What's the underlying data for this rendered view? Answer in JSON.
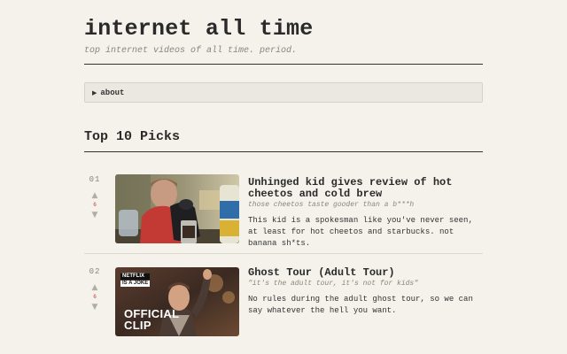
{
  "site": {
    "title": "internet all time",
    "tagline": "top internet videos of all time. period."
  },
  "about": {
    "label": "about",
    "arrow_icon": "triangle-right-icon"
  },
  "picks": {
    "heading": "Top 10 Picks",
    "items": [
      {
        "rank": "01",
        "title": "Unhinged kid gives review of hot cheetos and cold brew",
        "subtitle": "those cheetos taste gooder than a b***h",
        "description": "This kid is a spokesman like you've never seen, at least for hot cheetos and starbucks. not banana sh*ts.",
        "vote_count": "6",
        "thumbnail": {
          "kind": "video-thumbnail"
        }
      },
      {
        "rank": "02",
        "title": "Ghost Tour (Adult Tour)",
        "subtitle": "\"it's the adult tour, it's not for kids\"",
        "description": "No rules during the adult ghost tour, so we can say whatever the hell you want.",
        "vote_count": "6",
        "thumbnail": {
          "kind": "video-thumbnail",
          "badge_line1": "NETFLIX",
          "badge_line2": "IS A JOKE",
          "overlay_line1": "OFFICIAL",
          "overlay_line2": "CLIP"
        }
      }
    ]
  },
  "colors": {
    "background": "#f5f2eb",
    "text": "#222222",
    "muted": "#8a857b",
    "vote_count": "#c0392b",
    "about_box": "#ebe8e1"
  }
}
